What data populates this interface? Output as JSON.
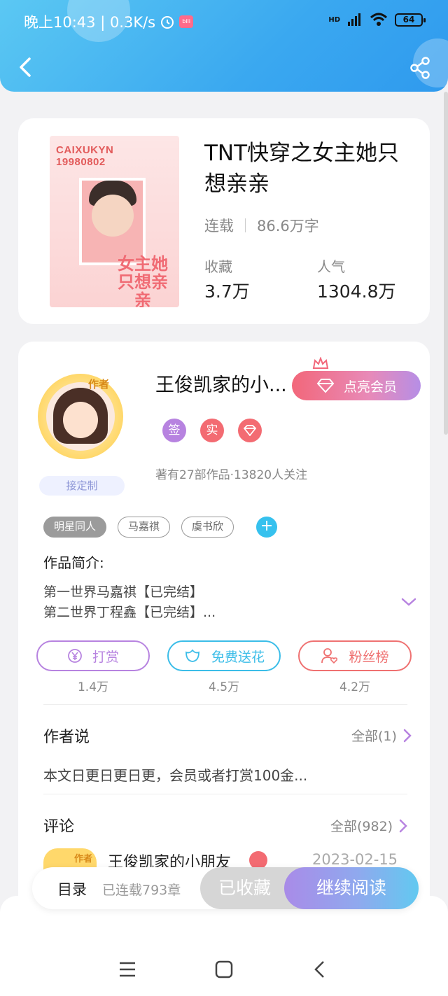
{
  "status_bar": {
    "time_speed": "晚上10:43 | 0.3K/s",
    "network": "HD",
    "battery": "64"
  },
  "book": {
    "title": "TNT快穿之女主她只想亲亲",
    "status": "连载",
    "word_count": "86.6万字",
    "fav_label": "收藏",
    "fav_value": "3.7万",
    "pop_label": "人气",
    "pop_value": "1304.8万",
    "cover": {
      "code": "CAIXUKYN",
      "date": "19980802",
      "big_text": "女主她只想亲亲"
    }
  },
  "author": {
    "name": "王俊凯家的小...",
    "avatar_tag": "作者",
    "custom_tag": "接定制",
    "vip_button": "点亮会员",
    "badges": [
      "签",
      "实"
    ],
    "stats": "著有27部作品·13820人关注"
  },
  "tags": [
    "明星同人",
    "马嘉祺",
    "虞书欣"
  ],
  "tag_add": "+",
  "intro": {
    "label": "作品简介:",
    "lines": [
      "第一世界马嘉祺【已完结】",
      "第二世界丁程鑫【已完结】..."
    ]
  },
  "actions": [
    {
      "label": "打赏",
      "count": "1.4万",
      "color": "#b783e0"
    },
    {
      "label": "免费送花",
      "count": "4.5万",
      "color": "#3bbde8"
    },
    {
      "label": "粉丝榜",
      "count": "4.2万",
      "color": "#ef7171"
    }
  ],
  "author_says": {
    "label": "作者说",
    "more": "全部(1)",
    "text": "本文日更日更日更，会员或者打赏100金..."
  },
  "comments": {
    "label": "评论",
    "more": "全部(982)",
    "first": {
      "name": "王俊凯家的小朋友",
      "date": "2023-02-15",
      "avatar_tag": "作者"
    }
  },
  "bottom_bar": {
    "toc": "目录",
    "chapter_count": "已连载793章",
    "favorited": "已收藏",
    "continue": "继续阅读"
  },
  "colors": {
    "header": "#3aa8f0",
    "accent_purple": "#a98be8",
    "accent_pink": "#f2677a"
  }
}
